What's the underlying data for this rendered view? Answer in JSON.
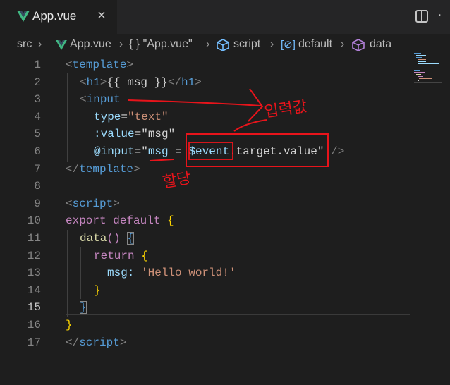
{
  "tab": {
    "label": "App.vue",
    "close": "×"
  },
  "breadcrumb": {
    "src": "src",
    "file": "App.vue",
    "component": "{ } \"App.vue\"",
    "script": "script",
    "default": "default",
    "data": "data"
  },
  "code": {
    "lines": [
      {
        "n": "1"
      },
      {
        "n": "2"
      },
      {
        "n": "3"
      },
      {
        "n": "4"
      },
      {
        "n": "5"
      },
      {
        "n": "6"
      },
      {
        "n": "7"
      },
      {
        "n": "8"
      },
      {
        "n": "9"
      },
      {
        "n": "10"
      },
      {
        "n": "11"
      },
      {
        "n": "12"
      },
      {
        "n": "13"
      },
      {
        "n": "14"
      },
      {
        "n": "15"
      },
      {
        "n": "16"
      },
      {
        "n": "17"
      }
    ],
    "tokens": {
      "lt": "<",
      "gt": ">",
      "lt_slash": "</",
      "template": "template",
      "h1": "h1",
      "mustache": "{{ msg }}",
      "input": "input",
      "type_attr": "type",
      "eq": "=",
      "text_val": "\"text\"",
      "value_attr": ":value",
      "msg_q": "\"msg\"",
      "oninput_attr": "@input",
      "q": "\"",
      "msg": "msg",
      "assign": " = ",
      "event": "$event",
      "target_value": ".target.value",
      "close_self": " />",
      "script": "script",
      "export": "export",
      "default": "default",
      "brace_open": "{",
      "brace_close": "}",
      "data_fn": "data",
      "parens": "()",
      "return": "return",
      "msg_key": "msg:",
      "hello": "'Hello world!'"
    }
  },
  "annotations": {
    "input_value": "입력값",
    "assign": "할당"
  },
  "colors": {
    "background": "#1e1e1e",
    "tag": "#569cd6",
    "attr": "#9cdcfe",
    "string": "#ce9178",
    "keyword": "#c586c0",
    "function": "#dcdcaa",
    "annotation": "#e8141b",
    "vue_green": "#41b883"
  }
}
